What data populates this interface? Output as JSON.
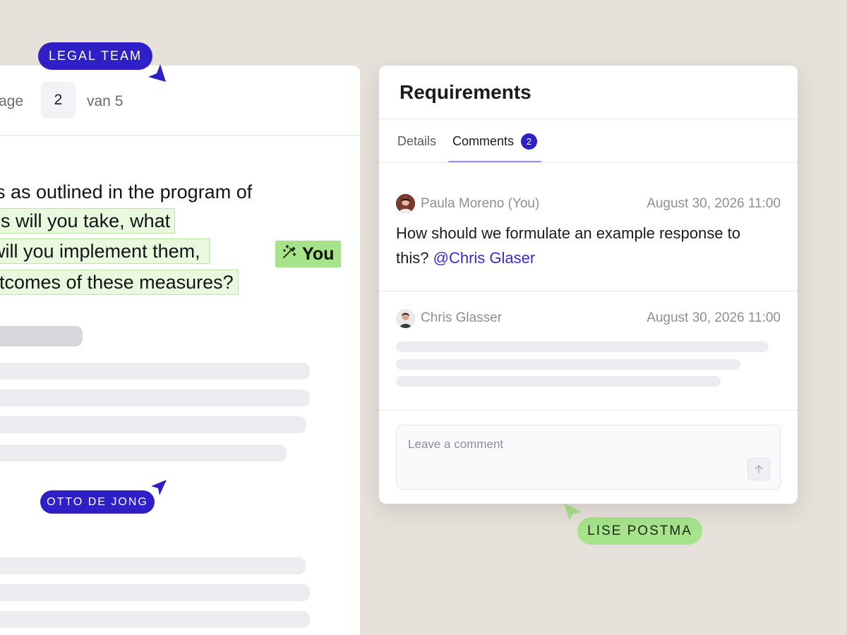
{
  "document": {
    "pager": {
      "label": "Page",
      "current": "2",
      "total_text": "van 5"
    },
    "lines": [
      "s as outlined in the program of",
      "es will you take, what",
      "will you implement them,",
      "utcomes of these measures?"
    ],
    "editor_tag": {
      "icon": "magic-pen-icon",
      "label": "You"
    }
  },
  "collaborators": {
    "legal_team": "LEGAL TEAM",
    "otto": "OTTO DE JONG",
    "lise": "LISE POSTMA"
  },
  "requirements": {
    "title": "Requirements",
    "tabs": [
      {
        "label": "Details",
        "active": false
      },
      {
        "label": "Comments",
        "active": true,
        "count": "2"
      }
    ],
    "comments": [
      {
        "author": "Paula Moreno (You)",
        "time": "August 30, 2026 11:00",
        "text": "How should we formulate an example response to this?",
        "mention": "@Chris Glaser"
      },
      {
        "author": "Chris Glasser",
        "time": "August 30, 2026 11:00"
      }
    ],
    "input": {
      "placeholder": "Leave a comment",
      "value": ""
    }
  },
  "colors": {
    "accent": "#2e1fc7",
    "highlight": "#e9f9de",
    "highlight_tag": "#a6e38b",
    "background": "#e6e1da"
  }
}
